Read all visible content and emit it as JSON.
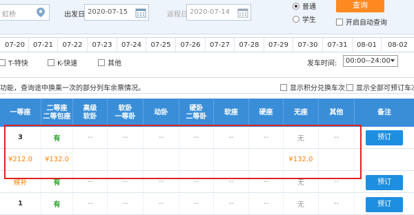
{
  "query": {
    "from_value": "虹桥",
    "depart_label": "出发日",
    "depart_date": "2020-07-15",
    "return_label": "返程日",
    "return_date": "2020-07-14",
    "ticket_types": [
      "普通",
      "学生"
    ],
    "selected_ticket_type": "普通",
    "query_label": "查询",
    "auto_query_label": "开启自动查询"
  },
  "dates": [
    "07-20",
    "07-21",
    "07-22",
    "07-23",
    "07-24",
    "07-25",
    "07-26",
    "07-27",
    "07-28",
    "07-29",
    "07-30",
    "07-31",
    "08-01",
    "08-02"
  ],
  "filters": {
    "train_types": [
      "T-特快",
      "K-快速",
      "其他"
    ],
    "time_label": "发车时间:",
    "time_value": "00:00--24:00"
  },
  "notice": {
    "text": "功能，查询途中换乘一次的部分列车余票情况。",
    "option1": "显示积分兑换车次",
    "option2": "显示全部可预订车次"
  },
  "table": {
    "headers": [
      [
        "一等座"
      ],
      [
        "二等座",
        "二等包座"
      ],
      [
        "高级",
        "软卧"
      ],
      [
        "软卧",
        "一等卧"
      ],
      [
        "动卧"
      ],
      [
        "硬卧",
        "二等卧"
      ],
      [
        "软座"
      ],
      [
        "硬座"
      ],
      [
        "无座"
      ],
      [
        "其他"
      ],
      [
        "备注"
      ]
    ],
    "rows": [
      {
        "cells": [
          "3",
          "有",
          "--",
          "--",
          "--",
          "--",
          "--",
          "--",
          "无",
          "--"
        ],
        "book": "预订"
      },
      {
        "prices": [
          "¥212.0",
          "¥132.0",
          "",
          "",
          "",
          "",
          "",
          "",
          "¥132.0",
          ""
        ]
      },
      {
        "cells": [
          "候补",
          "有",
          "--",
          "--",
          "--",
          "--",
          "--",
          "--",
          "无",
          "--"
        ],
        "book": "预订"
      },
      {
        "cells": [
          "1",
          "有",
          "--",
          "--",
          "--",
          "--",
          "--",
          "--",
          "无",
          "--"
        ],
        "book": "预订"
      }
    ]
  },
  "colors": {
    "header_blue": "#3a8ed8",
    "book_blue": "#1e8fe0",
    "orange": "#ff8a22",
    "green": "#2aa52a",
    "highlight_red": "#e0201f"
  }
}
